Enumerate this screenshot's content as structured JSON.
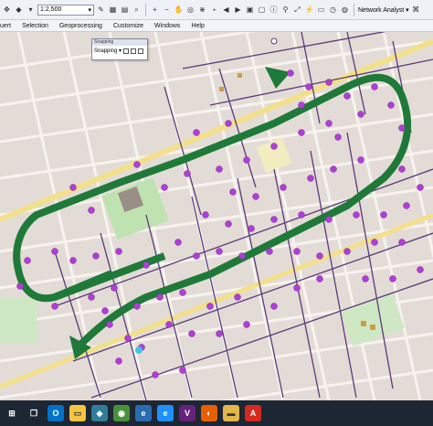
{
  "toolbar": {
    "scale_value": "1:2,500",
    "network_analyst_label": "Network Analyst ▾"
  },
  "menu": {
    "items": [
      "uert",
      "Selection",
      "Geoprocessing",
      "Customize",
      "Windows",
      "Help"
    ]
  },
  "snapping": {
    "title": "Snapping",
    "label": "Snapping ▾"
  },
  "colors": {
    "map_bg": "#e3dcd6",
    "route": "#1f7a3a",
    "stop": "#b03ed6",
    "street": "#5a3a7a"
  },
  "taskbar": {
    "icons": [
      "windows-start-icon",
      "task-view-icon",
      "outlook-icon",
      "file-explorer-icon",
      "arcgis-icon",
      "chrome-icon",
      "edge-icon",
      "ie-icon",
      "visual-studio-icon",
      "firefox-icon",
      "folder-icon",
      "acrobat-icon"
    ]
  }
}
